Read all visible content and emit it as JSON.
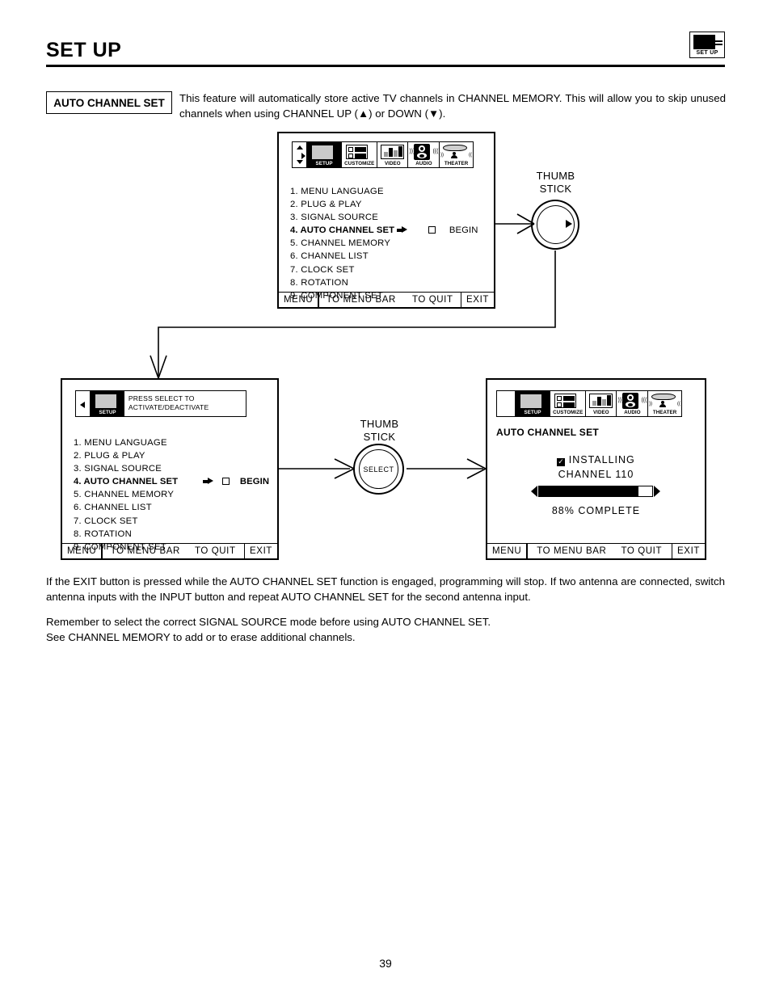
{
  "header": {
    "title": "SET UP",
    "badge_label": "SET UP",
    "badge_icon": "tv-setup-icon"
  },
  "intro": {
    "feature_label": "AUTO CHANNEL SET",
    "text": "This feature will automatically store active TV channels in CHANNEL MEMORY.  This will allow you to skip unused channels when using CHANNEL UP (▲) or DOWN (▼)."
  },
  "icon_bar": {
    "items": [
      {
        "label": "SETUP",
        "icon": "tv-screen-icon",
        "active": true
      },
      {
        "label": "CUSTOMIZE",
        "icon": "v-chip-icon",
        "active": false
      },
      {
        "label": "VIDEO",
        "icon": "bar-levels-icon",
        "active": false
      },
      {
        "label": "AUDIO",
        "icon": "speaker-icon",
        "active": false
      },
      {
        "label": "THEATER",
        "icon": "theater-seat-icon",
        "active": false
      }
    ]
  },
  "menu": {
    "items": [
      "1. MENU LANGUAGE",
      "2. PLUG & PLAY",
      "3. SIGNAL SOURCE",
      "4. AUTO CHANNEL SET",
      "5. CHANNEL MEMORY",
      "6. CHANNEL LIST",
      "7. CLOCK SET",
      "8. ROTATION",
      "9. COMPONENT SET"
    ],
    "selected_index": 3,
    "begin_label": "BEGIN",
    "footer": {
      "menu": "MENU",
      "to_menu_bar": "TO MENU BAR",
      "to_quit": "TO QUIT",
      "exit": "EXIT"
    }
  },
  "tooltip": {
    "line1": "PRESS SELECT TO",
    "line2": "ACTIVATE/DEACTIVATE",
    "back_arrow_icon": "left-triangle-icon"
  },
  "thumbstick_top": {
    "label_line1": "THUMB",
    "label_line2": "STICK"
  },
  "thumbstick_mid": {
    "label_line1": "THUMB",
    "label_line2": "STICK",
    "button_label": "SELECT"
  },
  "progress_screen": {
    "title": "AUTO CHANNEL SET",
    "installing_label": "INSTALLING",
    "channel_label": "CHANNEL 110",
    "percent_label": "88% COMPLETE",
    "percent_value": 88,
    "checkbox_glyph": "✓",
    "footer": {
      "menu": "MENU",
      "to_menu_bar": "TO MENU BAR",
      "to_quit": "TO QUIT",
      "exit": "EXIT"
    }
  },
  "notes": {
    "paragraph1": "If the EXIT button is pressed while the AUTO CHANNEL SET function is engaged, programming will stop.  If two antenna are connected, switch antenna inputs with the INPUT button and repeat AUTO CHANNEL SET for the second antenna input.",
    "paragraph2_line1": "Remember to select the correct SIGNAL SOURCE mode before using AUTO CHANNEL SET.",
    "paragraph2_line2": "See CHANNEL MEMORY to add or to erase additional channels."
  },
  "footer": {
    "page_number": "39"
  },
  "colors": {
    "ink": "#000000",
    "paper": "#ffffff",
    "screen_gray": "#c9c9c9"
  }
}
